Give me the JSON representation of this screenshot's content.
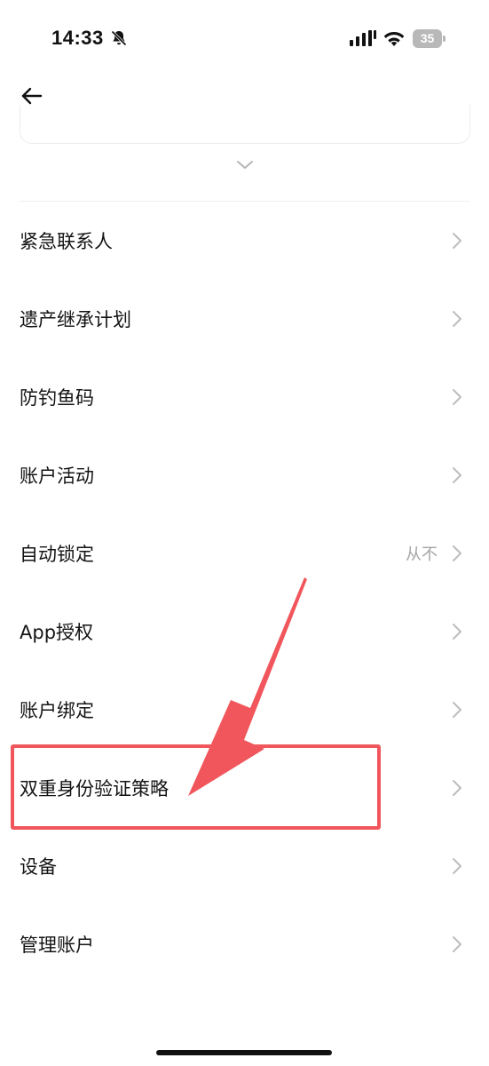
{
  "status_bar": {
    "time": "14:33",
    "battery": "35",
    "icons": [
      "bell-muted-icon",
      "signal-icon",
      "wifi-icon",
      "battery-icon"
    ]
  },
  "nav": {
    "back_icon": "back-arrow-icon",
    "expand_icon": "chevron-down-icon"
  },
  "menu": {
    "items": [
      {
        "label": "紧急联系人",
        "value": ""
      },
      {
        "label": "遗产继承计划",
        "value": ""
      },
      {
        "label": "防钓鱼码",
        "value": ""
      },
      {
        "label": "账户活动",
        "value": ""
      },
      {
        "label": "自动锁定",
        "value": "从不"
      },
      {
        "label": "App授权",
        "value": ""
      },
      {
        "label": "账户绑定",
        "value": ""
      },
      {
        "label": "双重身份验证策略",
        "value": ""
      },
      {
        "label": "设备",
        "value": ""
      },
      {
        "label": "管理账户",
        "value": ""
      }
    ]
  },
  "annotation": {
    "color": "#f0565b",
    "highlighted_item": "双重身份验证策略"
  }
}
